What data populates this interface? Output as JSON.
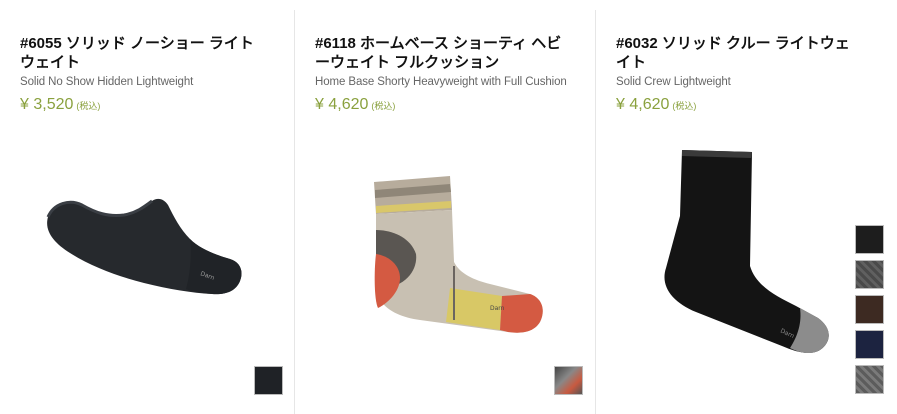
{
  "products": [
    {
      "title": "#6055 ソリッド ノーショー ライト ウェイト",
      "title_line1": "#6055 ソリッド ノーショー ライト",
      "title_line2": "ウェイト",
      "subtitle": "Solid No Show Hidden Lightweight",
      "price": "¥ 3,520",
      "tax_note": "(税込)",
      "swatches": [
        {
          "color": "#1f2226"
        }
      ]
    },
    {
      "title": "#6118 ホームベース ショーティ ヘビーウェイト フルクッション",
      "title_line1": "#6118 ホームベース ショーティ ヘビ",
      "title_line2": "ーウェイト フルクッション",
      "subtitle": "Home Base Shorty Heavyweight with Full Cushion",
      "price": "¥ 4,620",
      "tax_note": "(税込)",
      "swatches": [
        {
          "color": "#6e6a66"
        }
      ]
    },
    {
      "title": "#6032 ソリッド クルー ライトウェイト",
      "title_line1": "#6032 ソリッド クルー ライトウェ",
      "title_line2": "イト",
      "subtitle": "Solid Crew Lightweight",
      "price": "¥ 4,620",
      "tax_note": "(税込)",
      "swatches": [
        {
          "color": "#1d1d1d"
        },
        {
          "color": "#555555"
        },
        {
          "color": "#3d2a22"
        },
        {
          "color": "#1c2340"
        },
        {
          "color": "#6a6a6a"
        }
      ]
    }
  ],
  "colors": {
    "price": "#8aa13e",
    "divider": "#e6e6e6"
  }
}
